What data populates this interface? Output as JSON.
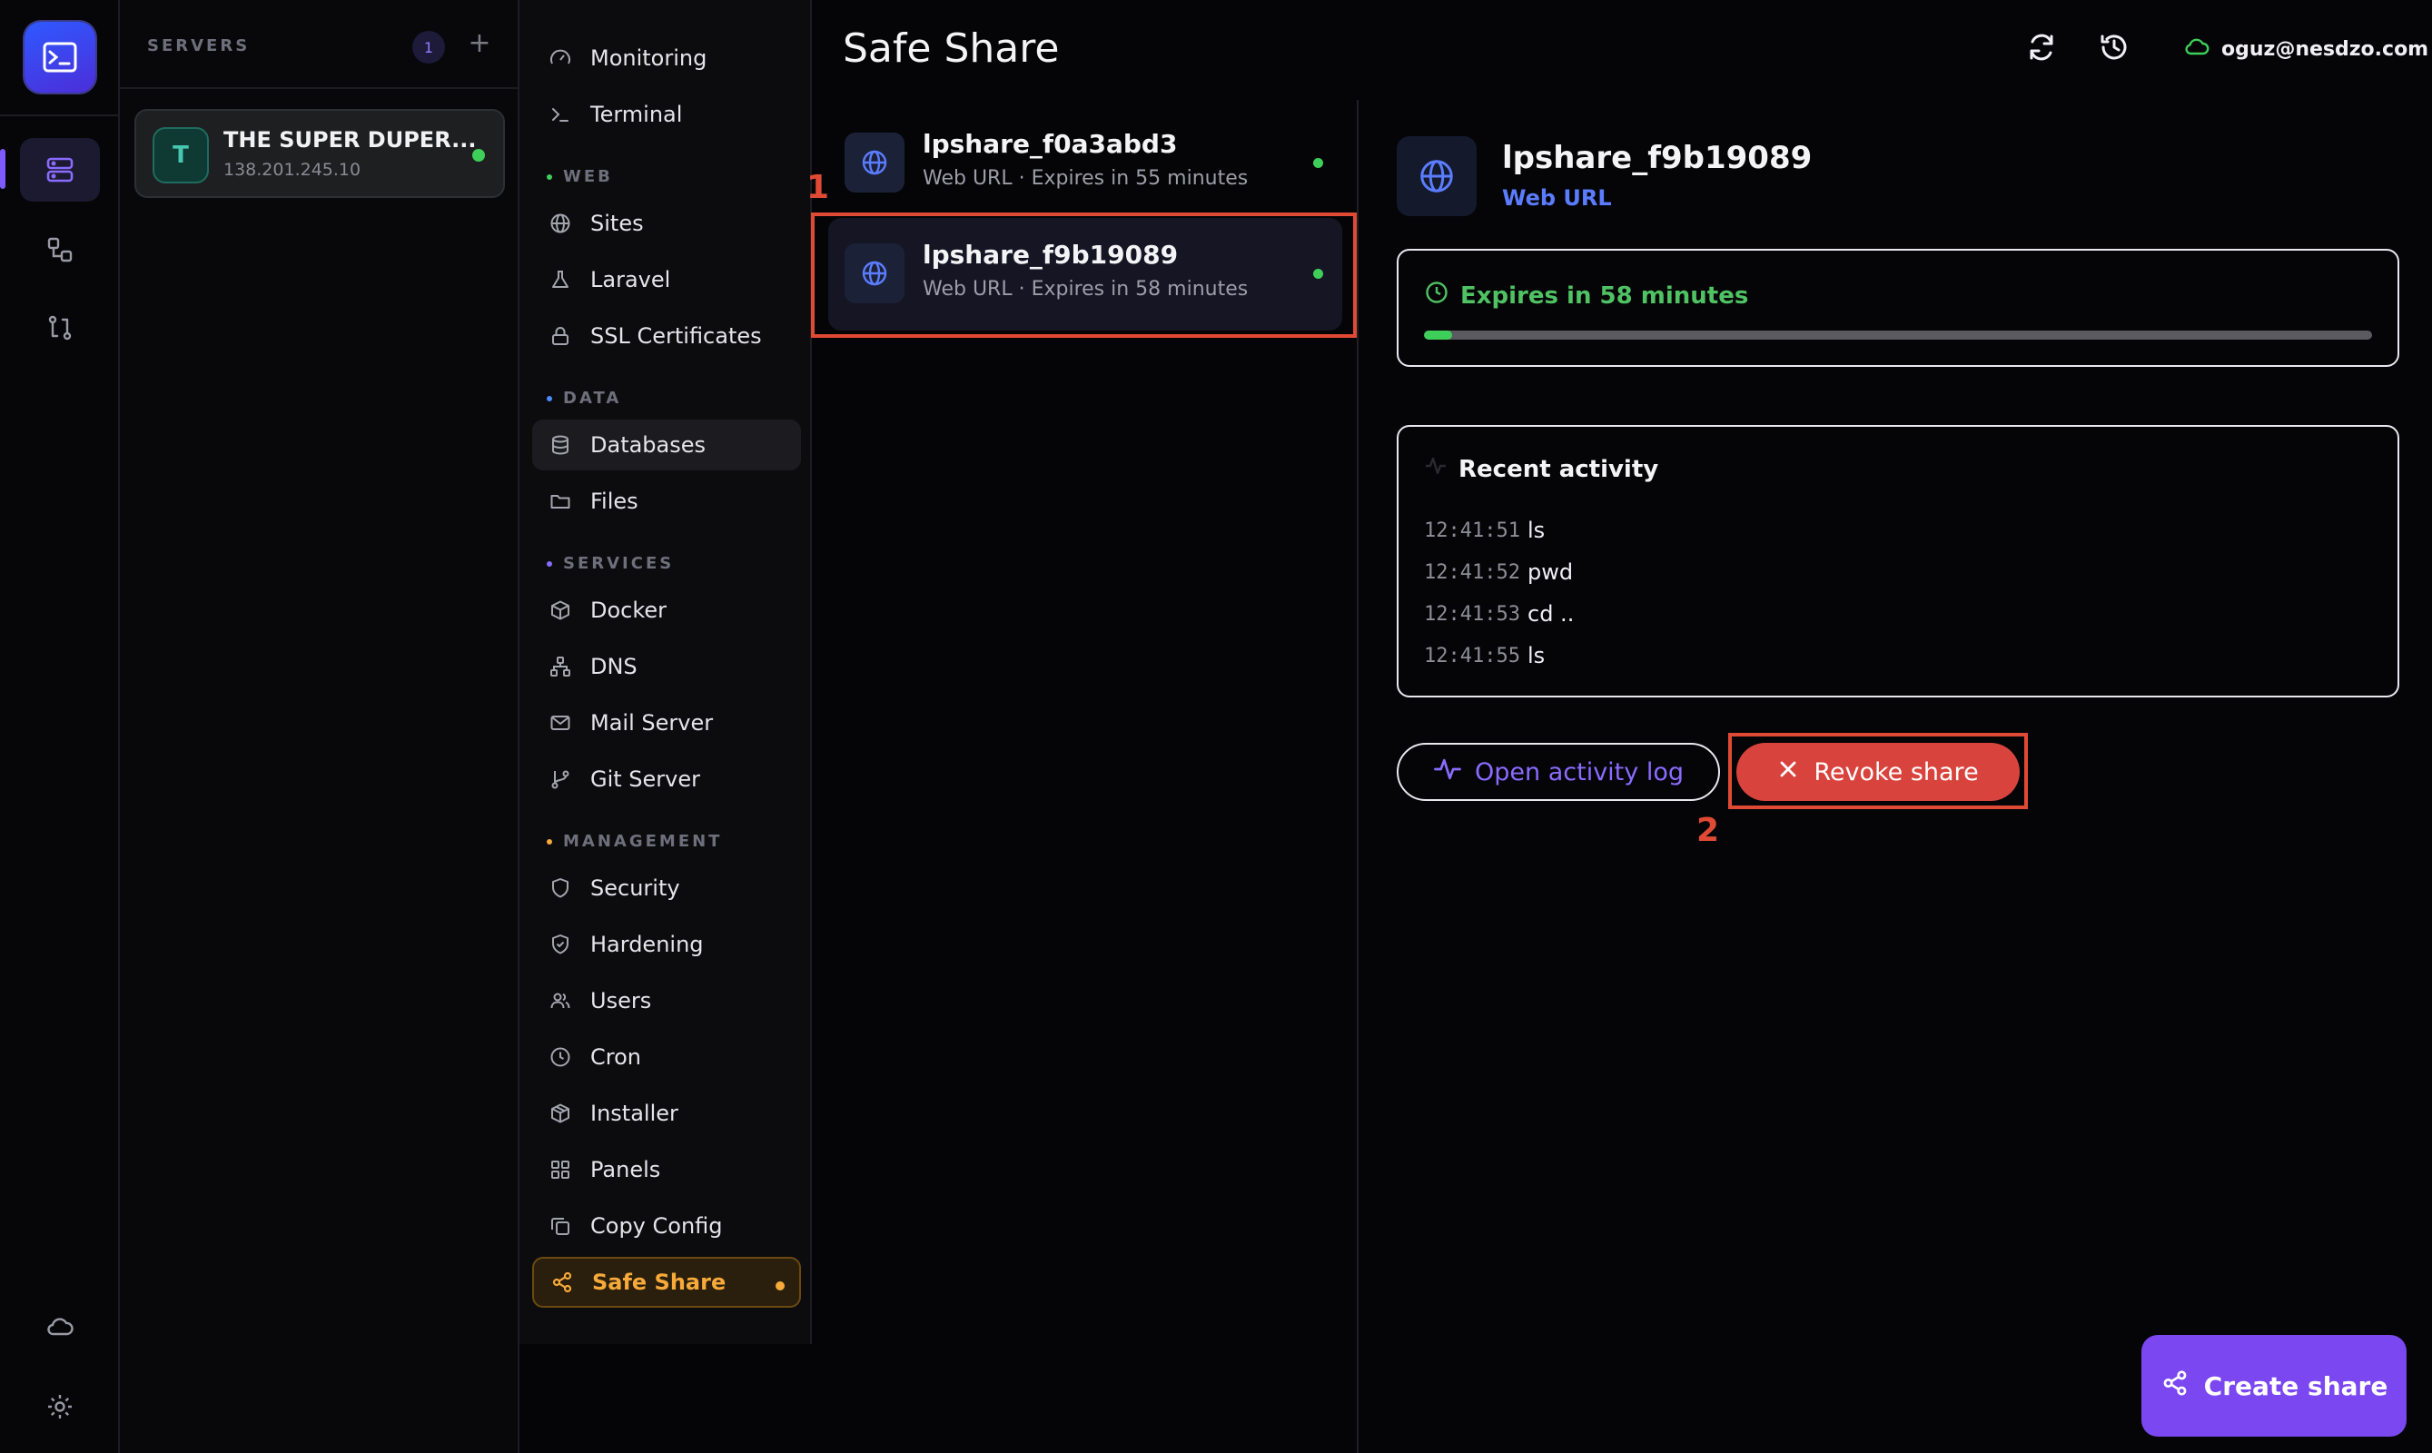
{
  "rail": {
    "icons": [
      "app-logo",
      "servers-icon",
      "nodes-icon",
      "transfer-icon",
      "cloud-icon",
      "gear-icon"
    ]
  },
  "servers": {
    "title": "SERVERS",
    "count": "1",
    "add_label": "+",
    "items": [
      {
        "initial": "T",
        "name": "THE SUPER DUPER...",
        "ip": "138.201.245.10",
        "status_color": "#3ecf5a"
      }
    ]
  },
  "nav": {
    "items": [
      {
        "label": "Monitoring",
        "icon": "gauge-icon"
      },
      {
        "label": "Terminal",
        "icon": "terminal-icon"
      },
      {
        "label": "Sites",
        "icon": "globe-icon"
      },
      {
        "label": "Laravel",
        "icon": "flask-icon"
      },
      {
        "label": "SSL Certificates",
        "icon": "lock-icon"
      },
      {
        "label": "Databases",
        "icon": "database-icon"
      },
      {
        "label": "Files",
        "icon": "folder-icon"
      },
      {
        "label": "Docker",
        "icon": "box-icon"
      },
      {
        "label": "DNS",
        "icon": "network-icon"
      },
      {
        "label": "Mail Server",
        "icon": "mail-icon"
      },
      {
        "label": "Git Server",
        "icon": "git-branch-icon"
      },
      {
        "label": "Security",
        "icon": "shield-icon"
      },
      {
        "label": "Hardening",
        "icon": "shield-check-icon"
      },
      {
        "label": "Users",
        "icon": "users-icon"
      },
      {
        "label": "Cron",
        "icon": "clock-icon"
      },
      {
        "label": "Installer",
        "icon": "package-icon"
      },
      {
        "label": "Panels",
        "icon": "grid-icon"
      },
      {
        "label": "Copy Config",
        "icon": "copy-icon"
      },
      {
        "label": "Safe Share",
        "icon": "share-icon"
      }
    ],
    "sections": [
      {
        "label": "WEB",
        "color": "#3ecf5a"
      },
      {
        "label": "DATA",
        "color": "#4a8cff"
      },
      {
        "label": "SERVICES",
        "color": "#8a6bff"
      },
      {
        "label": "MANAGEMENT",
        "color": "#f7a93a"
      }
    ],
    "active_color": "#f7a93a"
  },
  "header": {
    "title": "Safe Share",
    "user": "oguz@nesdzo.com"
  },
  "shares": [
    {
      "name": "lpshare_f0a3abd3",
      "subtitle": "Web URL · Expires in 55 minutes"
    },
    {
      "name": "lpshare_f9b19089",
      "subtitle": "Web URL · Expires in 58 minutes"
    }
  ],
  "annotations": {
    "first": "1",
    "second": "2",
    "color": "#e04a35"
  },
  "detail": {
    "name": "lpshare_f9b19089",
    "type": "Web URL",
    "expiry_label": "Expires in 58 minutes",
    "expiry_progress": 0.03,
    "activity_title": "Recent activity",
    "activity": [
      {
        "time": "12:41:51",
        "cmd": "ls"
      },
      {
        "time": "12:41:52",
        "cmd": "pwd"
      },
      {
        "time": "12:41:53",
        "cmd": "cd .."
      },
      {
        "time": "12:41:55",
        "cmd": "ls"
      }
    ],
    "open_log_label": "Open activity log",
    "revoke_label": "Revoke share"
  },
  "create_share_label": "Create share",
  "colors": {
    "accent": "#7a47f0",
    "danger": "#d9433d",
    "success": "#3ecf5a",
    "link": "#5b7cff"
  }
}
